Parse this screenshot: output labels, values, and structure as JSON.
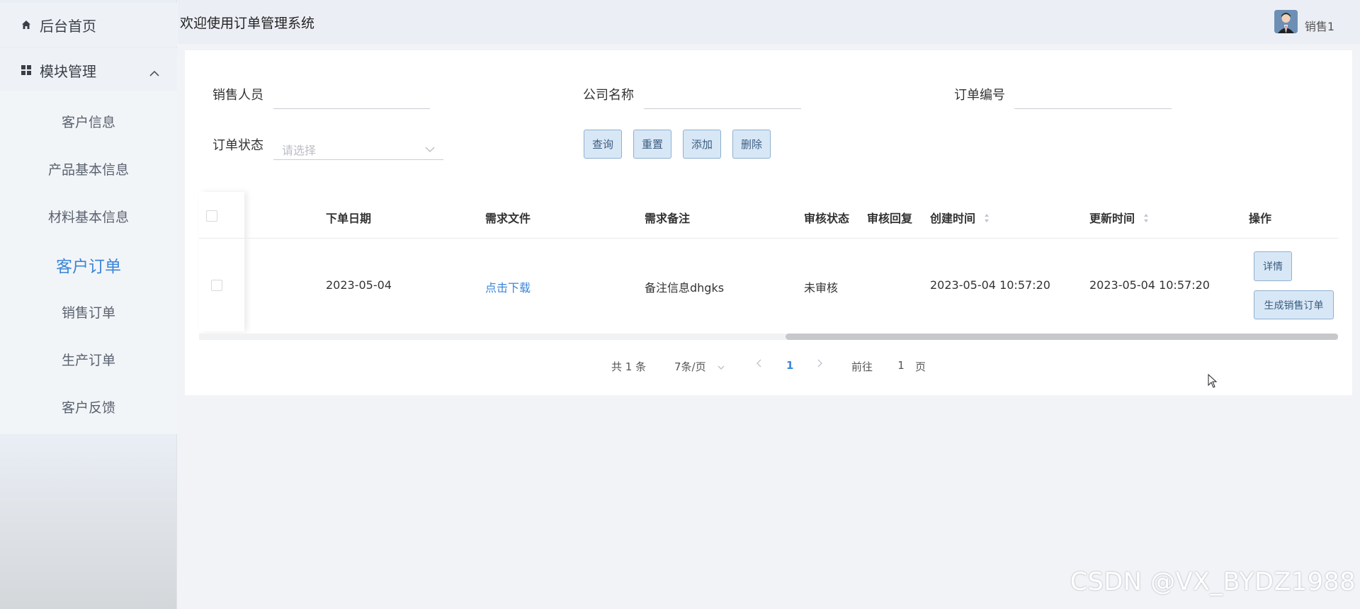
{
  "sidebar": {
    "home_label": "后台首页",
    "module_label": "模块管理",
    "items": [
      {
        "label": "客户信息"
      },
      {
        "label": "产品基本信息"
      },
      {
        "label": "材料基本信息"
      },
      {
        "label": "客户订单"
      },
      {
        "label": "销售订单"
      },
      {
        "label": "生产订单"
      },
      {
        "label": "客户反馈"
      }
    ],
    "active_item": "客户订单"
  },
  "header": {
    "title": "欢迎使用订单管理系统",
    "user_name": "销售1"
  },
  "filters": {
    "salesperson_label": "销售人员",
    "salesperson_value": "",
    "company_label": "公司名称",
    "company_value": "",
    "order_no_label": "订单编号",
    "order_no_value": "",
    "status_label": "订单状态",
    "status_placeholder": "请选择"
  },
  "buttons": {
    "query": "查询",
    "reset": "重置",
    "add": "添加",
    "delete": "删除"
  },
  "table": {
    "columns": [
      "下单日期",
      "需求文件",
      "需求备注",
      "审核状态",
      "审核回复",
      "创建时间",
      "更新时间",
      "操作"
    ],
    "rows": [
      {
        "order_date": "2023-05-04",
        "file_link": "点击下载",
        "note": "备注信息dhgks",
        "audit_status": "未审核",
        "audit_reply": "",
        "created": "2023-05-04 10:57:20",
        "updated": "2023-05-04 10:57:20",
        "actions": [
          "详情",
          "生成销售订单"
        ]
      }
    ]
  },
  "pagination": {
    "total": "共 1 条",
    "page_size": "7条/页",
    "current_page": "1",
    "goto_label": "前往",
    "goto_value": "1",
    "page_suffix": "页"
  },
  "watermark": "CSDN @VX_BYDZ1988",
  "colors": {
    "accent": "#3b86d9",
    "button_bg": "#d8e7f6",
    "button_border": "#8fb0cf",
    "sidebar_bg": "#e9eef5"
  }
}
